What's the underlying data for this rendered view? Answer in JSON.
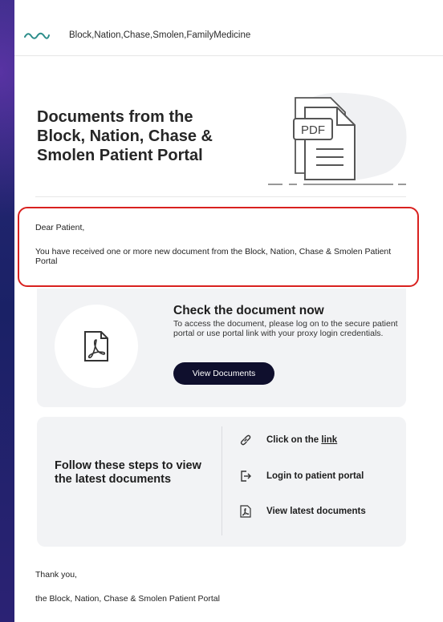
{
  "brand": {
    "name": "Block,Nation,Chase,Smolen,FamilyMedicine",
    "accent_color": "#2c8d8a"
  },
  "hero": {
    "title": "Documents from the Block, Nation, Chase & Smolen Patient Portal",
    "illustration_label": "PDF"
  },
  "message": {
    "greeting": "Dear Patient,",
    "body": "You have received one or more new document from the Block, Nation, Chase & Smolen Patient Portal",
    "highlight_color": "#d9211f"
  },
  "check_card": {
    "title": "Check the document now",
    "text": "To access the document, please log on to the secure patient portal or use portal link with your proxy login credentials.",
    "button_label": "View Documents",
    "icon": "pdf-icon"
  },
  "steps_card": {
    "title": "Follow these steps to view the latest documents",
    "steps": [
      {
        "prefix": "Click on the ",
        "link": "link",
        "icon": "link-icon"
      },
      {
        "label": "Login to patient portal",
        "icon": "login-icon"
      },
      {
        "label": "View latest documents",
        "icon": "pdf-icon"
      }
    ]
  },
  "footer": {
    "thanks": "Thank you,",
    "signature": "the Block, Nation, Chase & Smolen Patient Portal"
  }
}
